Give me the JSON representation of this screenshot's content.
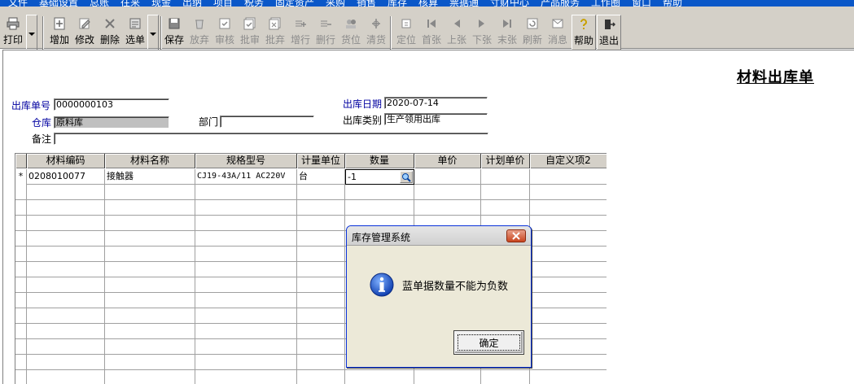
{
  "menu": [
    "文件",
    "基础设置",
    "总账",
    "往来",
    "现金",
    "出纳",
    "项目",
    "税务",
    "固定资产",
    "采购",
    "销售",
    "库存",
    "核算",
    "票据通",
    "寸财中心",
    "产品服务",
    "工作圈",
    "窗口",
    "帮助"
  ],
  "toolbar": {
    "print": "打印",
    "add": "增加",
    "edit": "修改",
    "delete": "删除",
    "select": "选单",
    "save": "保存",
    "discard": "放弃",
    "audit": "审核",
    "batch_audit": "批审",
    "batch_discard": "批弃",
    "add_row": "增行",
    "delete_row": "删行",
    "location": "货位",
    "clear": "清货",
    "locate": "定位",
    "first": "首张",
    "prev": "上张",
    "next": "下张",
    "last": "末张",
    "refresh": "刷新",
    "message": "消息",
    "help": "帮助",
    "exit": "退出"
  },
  "form": {
    "title": "材料出库单",
    "order_no_label": "出库单号",
    "order_no": "0000000103",
    "date_label": "出库日期",
    "date": "2020-07-14",
    "warehouse_label": "仓库",
    "warehouse": "原料库",
    "department_label": "部门",
    "department": "",
    "type_label": "出库类别",
    "type": "生产领用出库",
    "remark_label": "备注",
    "remark": ""
  },
  "grid": {
    "headers": [
      "材料编码",
      "材料名称",
      "规格型号",
      "计量单位",
      "数量",
      "单价",
      "计划单价",
      "自定义项2"
    ],
    "rows": [
      {
        "indicator": "*",
        "code": "0208010077",
        "name": "接触器",
        "spec": "CJ19-43A/11 AC220V",
        "unit": "台",
        "qty": "-1",
        "price": "",
        "plan_price": "",
        "custom2": ""
      }
    ]
  },
  "dialog": {
    "title": "库存管理系统",
    "message": "蓝单据数量不能为负数",
    "ok": "确定"
  },
  "colors": {
    "menubar": "#0a57c8",
    "toolbar_bg": "#d4d0c8",
    "label_blue": "#0000a0",
    "close_red": "#c8451f"
  }
}
